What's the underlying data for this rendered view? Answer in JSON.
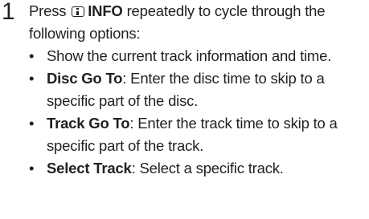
{
  "step": {
    "number": "1",
    "intro": {
      "before": "Press ",
      "key_icon": "info-icon",
      "key_name": "INFO",
      "after": " repeatedly to cycle through the following options:"
    },
    "options": [
      {
        "bullet": "•",
        "term": "",
        "separator": "",
        "text": "Show the current track information and time."
      },
      {
        "bullet": "•",
        "term": "Disc Go To",
        "separator": ":",
        "text": " Enter the disc time to skip to a specific part of the disc."
      },
      {
        "bullet": "•",
        "term": "Track Go To",
        "separator": ":",
        "text": " Enter the track time to skip to a specific part of the track."
      },
      {
        "bullet": "•",
        "term": "Select Track",
        "separator": ":",
        "text": " Select a specific track."
      }
    ]
  }
}
